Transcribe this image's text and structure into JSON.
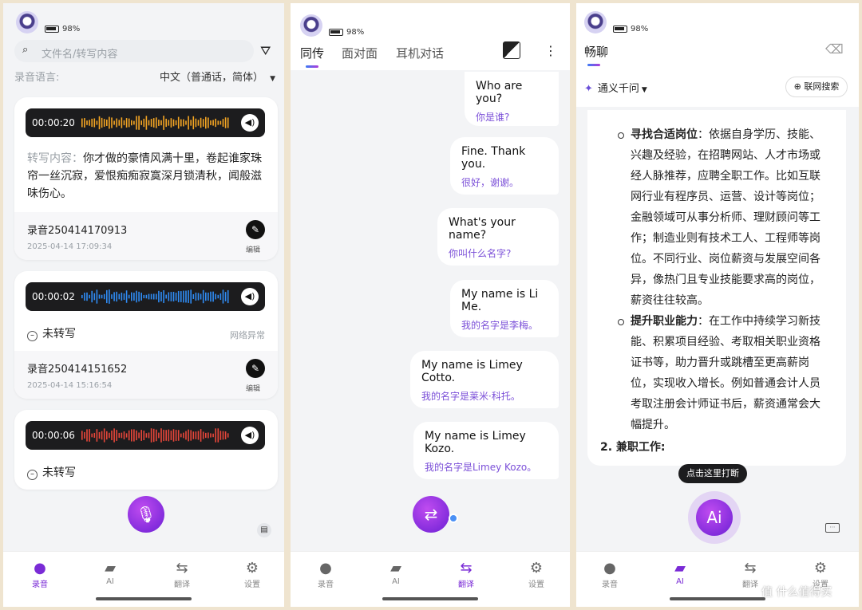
{
  "status": {
    "battery": "98%"
  },
  "p1": {
    "search_placeholder": "文件名/转写内容",
    "lang_label": "录音语言:",
    "lang_value": "中文（普通话，简体）",
    "card1": {
      "duration": "00:00:20",
      "transcript_label": "转写内容：",
      "transcript_l1": "你才做的豪情风满十里，卷起谁家珠",
      "transcript_l2": "帘一丝沉寂，爱恨痴痴寂寞深月锁清秋，闻般滋",
      "transcript_l3": "味伤心。",
      "name": "录音250414170913",
      "time": "2025-04-14 17:09:34",
      "edit": "编辑"
    },
    "card2": {
      "duration": "00:00:02",
      "status": "未转写",
      "net": "网络异常",
      "name": "录音250414151652",
      "time": "2025-04-14 15:16:54",
      "edit": "编辑"
    },
    "card3": {
      "duration": "00:00:06",
      "status": "未转写"
    },
    "nav": [
      "录音",
      "AI",
      "翻译",
      "设置"
    ]
  },
  "p2": {
    "tabs": [
      "同传",
      "面对面",
      "耳机对话"
    ],
    "bubbles": [
      {
        "en": "Who are you?",
        "zh": "你是谁?"
      },
      {
        "en": "Fine. Thank you.",
        "zh": "很好，谢谢。"
      },
      {
        "en": "What's your name?",
        "zh": "你叫什么名字?"
      },
      {
        "en": "My name is Li Me.",
        "zh": "我的名字是李梅。"
      },
      {
        "en": "My name is Limey Cotto.",
        "zh": "我的名字是莱米·科托。"
      },
      {
        "en": "My name is Limey Kozo.",
        "zh": "我的名字是Limey Kozo。"
      }
    ],
    "nav": [
      "录音",
      "AI",
      "翻译",
      "设置"
    ]
  },
  "p3": {
    "title": "畅聊",
    "model": "通义千问",
    "web_search": "联网搜索",
    "b1_title": "寻找合适岗位",
    "b1_l1": "：依据自身学历、技能、",
    "b1_l2": "兴趣及经验，在招聘网站、人才市场或",
    "b1_l3": "经人脉推荐，应聘全职工作。比如互联",
    "b1_l4": "网行业有程序员、运营、设计等岗位；",
    "b1_l5": "金融领域可从事分析师、理财顾问等工",
    "b1_l6": "作；制造业则有技术工人、工程师等岗",
    "b1_l7": "位。不同行业、岗位薪资与发展空间各",
    "b1_l8": "异，像热门且专业技能要求高的岗位，",
    "b1_l9": "薪资往往较高。",
    "b2_title": "提升职业能力",
    "b2_l1": "：在工作中持续学习新技",
    "b2_l2": "能、积累项目经验、考取相关职业资格",
    "b2_l3": "证书等，助力晋升或跳槽至更高薪岗",
    "b2_l4": "位，实现收入增长。例如普通会计人员",
    "b2_l5": "考取注册会计师证书后，薪资通常会大",
    "b2_l6": "幅提升。",
    "item2": "2. 兼职工作:",
    "tooltip": "点击这里打断",
    "fab": "Ai",
    "nav": [
      "录音",
      "AI",
      "翻译",
      "设置"
    ],
    "watermark": "值 什么值得买"
  }
}
